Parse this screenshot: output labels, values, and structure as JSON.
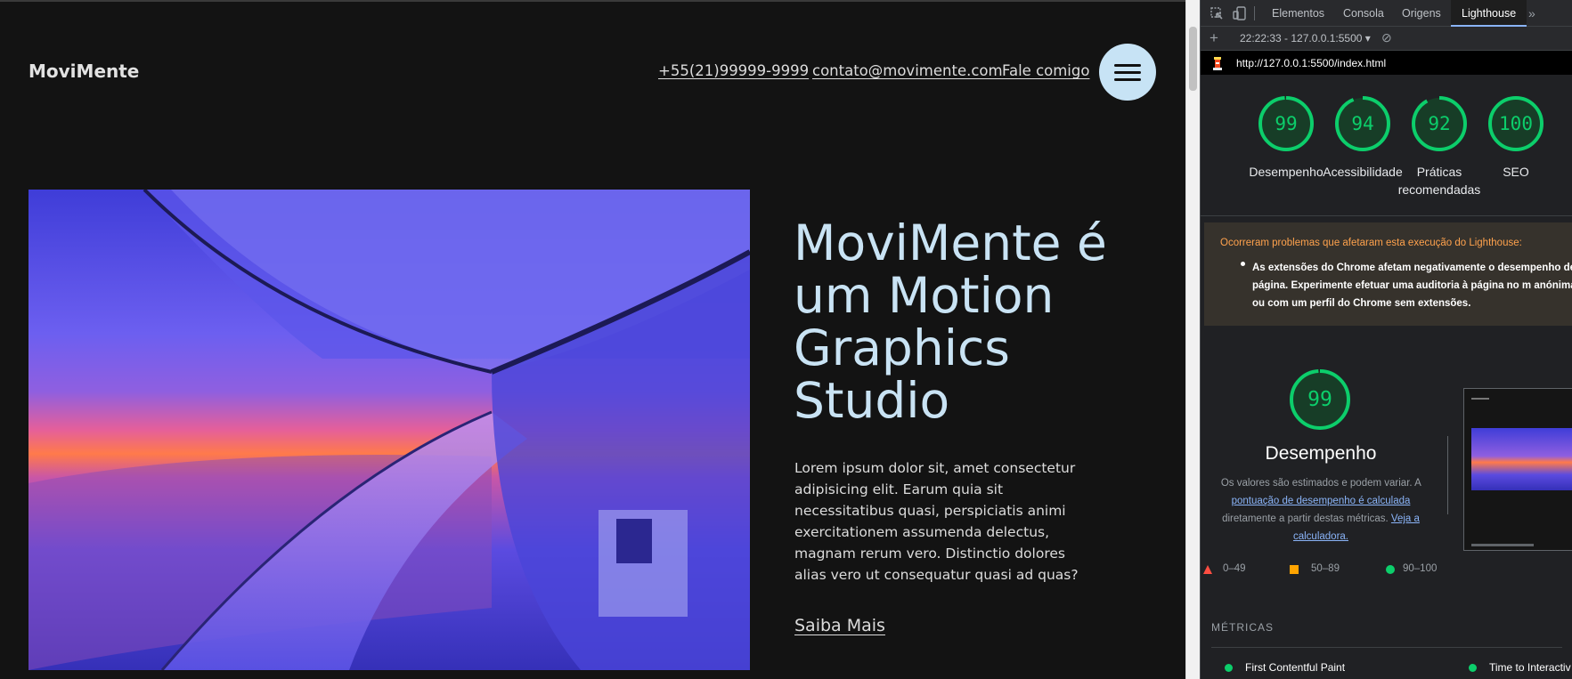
{
  "site": {
    "logo": "MoviMente",
    "nav": {
      "phone": "+55(21)99999-9999",
      "email": "contato@movimente.com",
      "contact": "Fale comigo"
    },
    "menu_icon": "hamburger-menu-icon",
    "hero": {
      "title": "MoviMente é um Motion Graphics Studio",
      "text": "Lorem ipsum dolor sit, amet consectetur adipisicing elit. Earum quia sit necessitatibus quasi, perspiciatis animi exercitationem assumenda delectus, magnam rerum vero. Distinctio dolores alias vero ut consequatur quasi ad quas?",
      "cta": "Saiba Mais"
    },
    "colors": {
      "bg": "#131313",
      "accent": "#c9e3f4",
      "menu_button": "#c7e3f5"
    }
  },
  "devtools": {
    "tabs": [
      "Elementos",
      "Consola",
      "Origens",
      "Lighthouse"
    ],
    "active_tab": "Lighthouse",
    "more_icon": "chevron-double-right-icon",
    "report_select": "22:22:33 - 127.0.0.1:5500 ▾",
    "url": "http://127.0.0.1:5500/index.html",
    "scores": [
      {
        "label": "Desempenho",
        "value": 99
      },
      {
        "label": "Acessibilidade",
        "value": 94
      },
      {
        "label": "Práticas recomendadas",
        "value": 92
      },
      {
        "label": "SEO",
        "value": 100
      }
    ],
    "warning": {
      "title": "Ocorreram problemas que afetaram esta execução do Lighthouse:",
      "item": "As extensões do Chrome afetam negativamente o desempenho desta página. Experimente efetuar uma auditoria à página no m anónima ou com um perfil do Chrome sem extensões."
    },
    "performance": {
      "score": 99,
      "title": "Desempenho",
      "desc_1": "Os valores são estimados e podem variar. A",
      "link_1": "pontuação de desempenho é calculada",
      "desc_2": "diretamente a partir destas métricas.",
      "link_2": "Veja a calculadora."
    },
    "legend": [
      "0–49",
      "50–89",
      "90–100"
    ],
    "metrics_heading": "MÉTRICAS",
    "metrics": [
      "First Contentful Paint",
      "Time to Interactiv"
    ],
    "colors": {
      "pass": "#0cce6b",
      "average": "#ffa400",
      "fail": "#ff4e42",
      "warning": "#ffa24d"
    }
  }
}
